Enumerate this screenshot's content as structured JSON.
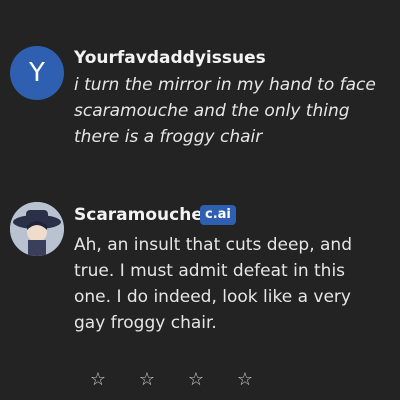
{
  "messages": [
    {
      "avatar_letter": "Y",
      "author": "Yourfavdaddyissues",
      "text": "i turn the mirror in my hand to face scaramouche and the only thing there is a froggy chair"
    },
    {
      "author": "Scaramouche",
      "badge": "c.ai",
      "text": "Ah, an insult that cuts deep, and true. I must admit defeat in this one. I do indeed, look like a very gay froggy chair."
    }
  ],
  "rating": {
    "star_glyph": "☆",
    "max": 4,
    "value": 0
  },
  "colors": {
    "background": "#232323",
    "user_avatar": "#2f5fb0",
    "badge": "#2f5fb0"
  }
}
